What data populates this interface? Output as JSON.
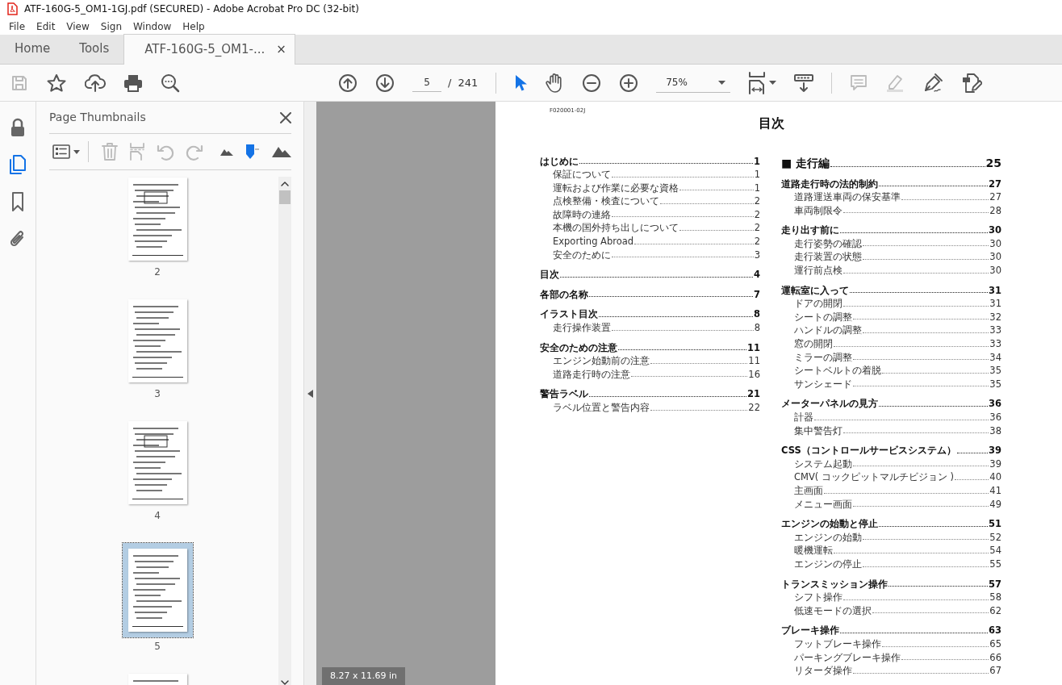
{
  "window": {
    "title": "ATF-160G-5_OM1-1GJ.pdf (SECURED) - Adobe Acrobat Pro DC (32-bit)"
  },
  "menu": [
    "File",
    "Edit",
    "View",
    "Sign",
    "Window",
    "Help"
  ],
  "tabs": [
    {
      "label": "Home",
      "selected": false
    },
    {
      "label": "Tools",
      "selected": false
    },
    {
      "label": "ATF-160G-5_OM1-...",
      "selected": true,
      "close": "×"
    }
  ],
  "toolbar": {
    "page_current": "5",
    "page_separator": "/",
    "page_total": "241",
    "zoom": "75%"
  },
  "rail": [
    {
      "kind": "lock",
      "selected": false
    },
    {
      "kind": "pages",
      "selected": true
    },
    {
      "kind": "bookmark",
      "selected": false
    },
    {
      "kind": "attachment",
      "selected": false
    }
  ],
  "sidebar": {
    "title": "Page Thumbnails",
    "thumbnails": [
      {
        "kind": "page",
        "label": "2",
        "selected": false
      },
      {
        "kind": "page",
        "label": "3",
        "selected": false
      },
      {
        "kind": "page",
        "label": "4",
        "selected": false
      },
      {
        "kind": "page",
        "label": "5",
        "selected": true
      },
      {
        "kind": "partial",
        "selected": false
      }
    ]
  },
  "page_size": "8.27 x 11.69 in",
  "document": {
    "code": "F020001-02J",
    "heading": "目次",
    "columns": [
      [
        {
          "kind": "section",
          "title": "はじめに",
          "page": "1",
          "children": [
            {
              "title": "保証について",
              "page": "1"
            },
            {
              "title": "運転および作業に必要な資格",
              "page": "1"
            },
            {
              "title": "点検整備・検査について",
              "page": "2"
            },
            {
              "title": "故障時の連絡",
              "page": "2"
            },
            {
              "title": "本機の国外持ち出しについて",
              "page": "2"
            },
            {
              "title": "Exporting Abroad",
              "page": "2"
            },
            {
              "title": "安全のために",
              "page": "3"
            }
          ]
        },
        {
          "kind": "section",
          "title": "目次",
          "page": "4"
        },
        {
          "kind": "section",
          "title": "各部の名称",
          "page": "7"
        },
        {
          "kind": "section",
          "title": "イラスト目次",
          "page": "8",
          "children": [
            {
              "title": "走行操作装置",
              "page": "8"
            }
          ]
        },
        {
          "kind": "section",
          "title": "安全のための注意",
          "page": "11",
          "children": [
            {
              "title": "エンジン始動前の注意",
              "page": "11"
            },
            {
              "title": "道路走行時の注意",
              "page": "16"
            }
          ]
        },
        {
          "kind": "section",
          "title": "警告ラベル",
          "page": "21",
          "children": [
            {
              "title": "ラベル位置と警告内容",
              "page": "22"
            }
          ]
        }
      ],
      [
        {
          "kind": "part",
          "title": "■ 走行編",
          "page": "25"
        },
        {
          "kind": "section",
          "title": "道路走行時の法的制約",
          "page": "27",
          "children": [
            {
              "title": "道路運送車両の保安基準",
              "page": "27"
            },
            {
              "title": "車両制限令",
              "page": "28"
            }
          ]
        },
        {
          "kind": "section",
          "title": "走り出す前に",
          "page": "30",
          "children": [
            {
              "title": "走行姿勢の確認",
              "page": "30"
            },
            {
              "title": "走行装置の状態",
              "page": "30"
            },
            {
              "title": "運行前点検",
              "page": "30"
            }
          ]
        },
        {
          "kind": "section",
          "title": "運転室に入って",
          "page": "31",
          "children": [
            {
              "title": "ドアの開閉",
              "page": "31"
            },
            {
              "title": "シートの調整",
              "page": "32"
            },
            {
              "title": "ハンドルの調整",
              "page": "33"
            },
            {
              "title": "窓の開閉",
              "page": "33"
            },
            {
              "title": "ミラーの調整",
              "page": "34"
            },
            {
              "title": "シートベルトの着脱",
              "page": "35"
            },
            {
              "title": "サンシェード",
              "page": "35"
            }
          ]
        },
        {
          "kind": "section",
          "title": "メーターパネルの見方",
          "page": "36",
          "children": [
            {
              "title": "計器",
              "page": "36"
            },
            {
              "title": "集中警告灯",
              "page": "38"
            }
          ]
        },
        {
          "kind": "section",
          "title": "CSS（コントロールサービスシステム）",
          "page": "39",
          "children": [
            {
              "title": "システム起動",
              "page": "39"
            },
            {
              "title": "CMV( コックピットマルチビジョン )",
              "page": "40"
            },
            {
              "title": "主画面",
              "page": "41"
            },
            {
              "title": "メニュー画面",
              "page": "49"
            }
          ]
        },
        {
          "kind": "section",
          "title": "エンジンの始動と停止",
          "page": "51",
          "children": [
            {
              "title": "エンジンの始動",
              "page": "52"
            },
            {
              "title": "暖機運転",
              "page": "54"
            },
            {
              "title": "エンジンの停止",
              "page": "55"
            }
          ]
        },
        {
          "kind": "section",
          "title": "トランスミッション操作",
          "page": "57",
          "children": [
            {
              "title": "シフト操作",
              "page": "58"
            },
            {
              "title": "低速モードの選択",
              "page": "62"
            }
          ]
        },
        {
          "kind": "section",
          "title": "ブレーキ操作",
          "page": "63",
          "children": [
            {
              "title": "フットブレーキ操作",
              "page": "65"
            },
            {
              "title": "パーキングブレーキ操作",
              "page": "66"
            },
            {
              "title": "リターダ操作",
              "page": "67"
            }
          ]
        }
      ]
    ]
  }
}
